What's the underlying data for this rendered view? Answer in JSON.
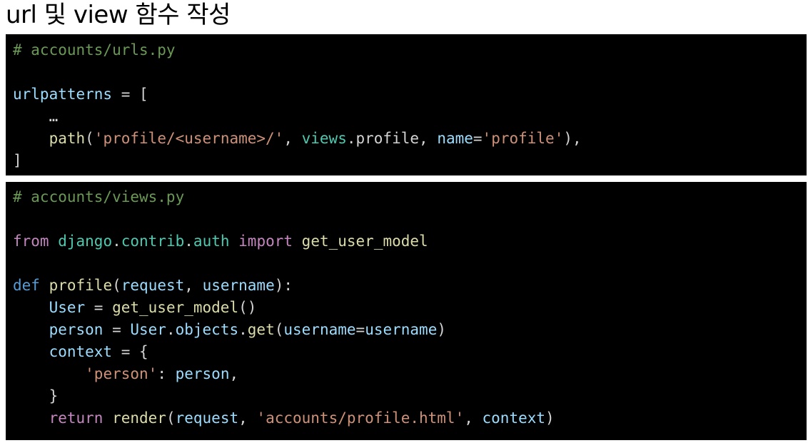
{
  "title": "url 및 view 함수 작성",
  "urls_block": {
    "comment": "# accounts/urls.py",
    "line_urlpatterns": {
      "name": "urlpatterns",
      "assign": " = ["
    },
    "ellipsis": "…",
    "path_line": {
      "func": "path",
      "open": "(",
      "route": "'profile/<username>/'",
      "sep1": ", ",
      "views_mod": "views",
      "dot": ".",
      "attr": "profile",
      "sep2": ", ",
      "kwarg": "name",
      "eq": "=",
      "name_val": "'profile'",
      "close": "),"
    },
    "close_bracket": "]"
  },
  "views_block": {
    "comment": "# accounts/views.py",
    "import_line": {
      "from_kw": "from",
      "pkg1": "django",
      "dot1": ".",
      "pkg2": "contrib",
      "dot2": ".",
      "pkg3": "auth",
      "import_kw": "import",
      "name": "get_user_model"
    },
    "def_line": {
      "def_kw": "def",
      "func": "profile",
      "open": "(",
      "p1": "request",
      "sep": ", ",
      "p2": "username",
      "close": "):"
    },
    "user_line": {
      "var": "User",
      "eq": " = ",
      "func": "get_user_model",
      "parens": "()"
    },
    "person_line": {
      "var": "person",
      "eq": " = ",
      "cls": "User",
      "dot1": ".",
      "objects": "objects",
      "dot2": ".",
      "get": "get",
      "open": "(",
      "kwarg": "username",
      "eq2": "=",
      "val": "username",
      "close": ")"
    },
    "context_line": {
      "var": "context",
      "eq": " = {"
    },
    "dict_line": {
      "key": "'person'",
      "colon": ": ",
      "val": "person",
      "comma": ","
    },
    "close_brace": "}",
    "return_line": {
      "return_kw": "return",
      "func": "render",
      "open": "(",
      "a1": "request",
      "sep1": ", ",
      "a2": "'accounts/profile.html'",
      "sep2": ", ",
      "a3": "context",
      "close": ")"
    }
  }
}
